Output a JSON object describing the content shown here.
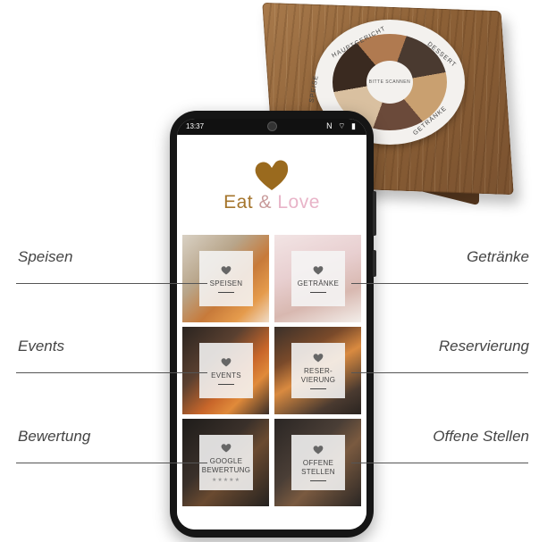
{
  "statusbar": {
    "time": "13:37",
    "icons": "N ⌔ ▮"
  },
  "brand": {
    "part1": "Eat",
    "ampersand": "&",
    "part2": "Love"
  },
  "tiles": [
    {
      "label": "SPEISEN",
      "icon": "heart-icon"
    },
    {
      "label": "GETRÄNKE",
      "icon": "heart-icon"
    },
    {
      "label": "EVENTS",
      "icon": "heart-icon"
    },
    {
      "label": "RESER-\nVIERUNG",
      "icon": "heart-icon"
    },
    {
      "label": "GOOGLE\nBEWERTUNG",
      "icon": "heart-icon",
      "stars": "★★★★★"
    },
    {
      "label": "OFFENE\nSTELLEN",
      "icon": "heart-icon"
    }
  ],
  "callouts": {
    "speisen": "Speisen",
    "getraenke": "Getränke",
    "events": "Events",
    "reservierung": "Reservierung",
    "bewertung": "Bewertung",
    "offene_stellen": "Offene Stellen"
  },
  "coaster": {
    "top": "HAUPTGERICHT",
    "right": "DESSERT",
    "bottom_right": "GETRÄNKE",
    "left": "SPEISE",
    "center": "BITTE SCANNEN"
  },
  "colors": {
    "brand_gold": "#a5752c",
    "brand_pink": "#e8b4c8",
    "wood": "#8c6036"
  }
}
